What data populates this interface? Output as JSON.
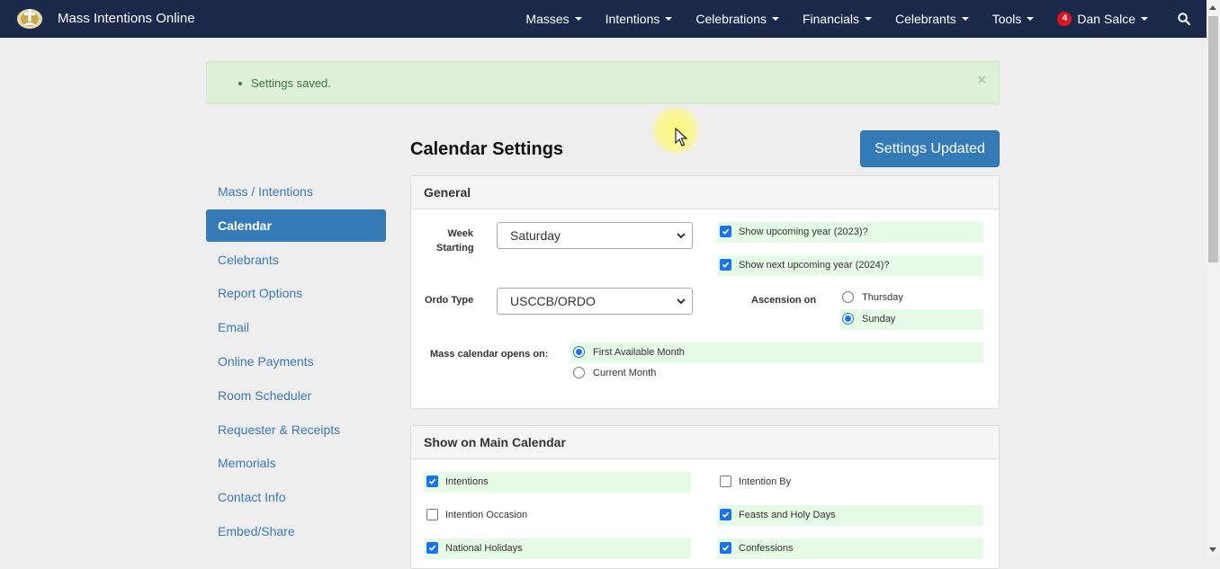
{
  "navbar": {
    "brand": "Mass Intentions Online",
    "items": [
      {
        "label": "Masses"
      },
      {
        "label": "Intentions"
      },
      {
        "label": "Celebrations"
      },
      {
        "label": "Financials"
      },
      {
        "label": "Celebrants"
      },
      {
        "label": "Tools"
      }
    ],
    "user": {
      "name": "Dan Salce",
      "notifications": "4"
    },
    "search_icon": "search-icon",
    "colors": {
      "background": "#1b2a4a",
      "badge": "#e0141e"
    }
  },
  "alert": {
    "message": "Settings saved.",
    "close": "×",
    "color": "#dff0d8"
  },
  "header": {
    "title": "Calendar Settings",
    "button_label": "Settings Updated",
    "accent": "#337ab7"
  },
  "sidebar": {
    "items": [
      {
        "label": "Mass / Intentions"
      },
      {
        "label": "Calendar",
        "active": true
      },
      {
        "label": "Celebrants"
      },
      {
        "label": "Report Options"
      },
      {
        "label": "Email"
      },
      {
        "label": "Online Payments"
      },
      {
        "label": "Room Scheduler"
      },
      {
        "label": "Requester & Receipts"
      },
      {
        "label": "Memorials"
      },
      {
        "label": "Contact Info"
      },
      {
        "label": "Embed/Share"
      }
    ]
  },
  "general": {
    "heading": "General",
    "week_starting": {
      "label_line1": "Week",
      "label_line2": "Starting",
      "value": "Saturday"
    },
    "ordo_type": {
      "label": "Ordo Type",
      "value": "USCCB/ORDO"
    },
    "show_upcoming_year": {
      "label": "Show upcoming year (2023)?",
      "checked": true
    },
    "show_next_upcoming_year": {
      "label": "Show next upcoming year (2024)?",
      "checked": true
    },
    "ascension": {
      "label": "Ascension on",
      "options": [
        {
          "label": "Thursday",
          "selected": false
        },
        {
          "label": "Sunday",
          "selected": true
        }
      ]
    },
    "mass_calendar_opens": {
      "label": "Mass calendar opens on:",
      "options": [
        {
          "label": "First Available Month",
          "selected": true
        },
        {
          "label": "Current Month",
          "selected": false
        }
      ]
    }
  },
  "main_calendar": {
    "heading": "Show on Main Calendar",
    "options": [
      {
        "label": "Intentions",
        "checked": true
      },
      {
        "label": "Intention By",
        "checked": false
      },
      {
        "label": "Intention Occasion",
        "checked": false
      },
      {
        "label": "Feasts and Holy Days",
        "checked": true
      },
      {
        "label": "National Holidays",
        "checked": true
      },
      {
        "label": "Confessions",
        "checked": true
      }
    ]
  }
}
